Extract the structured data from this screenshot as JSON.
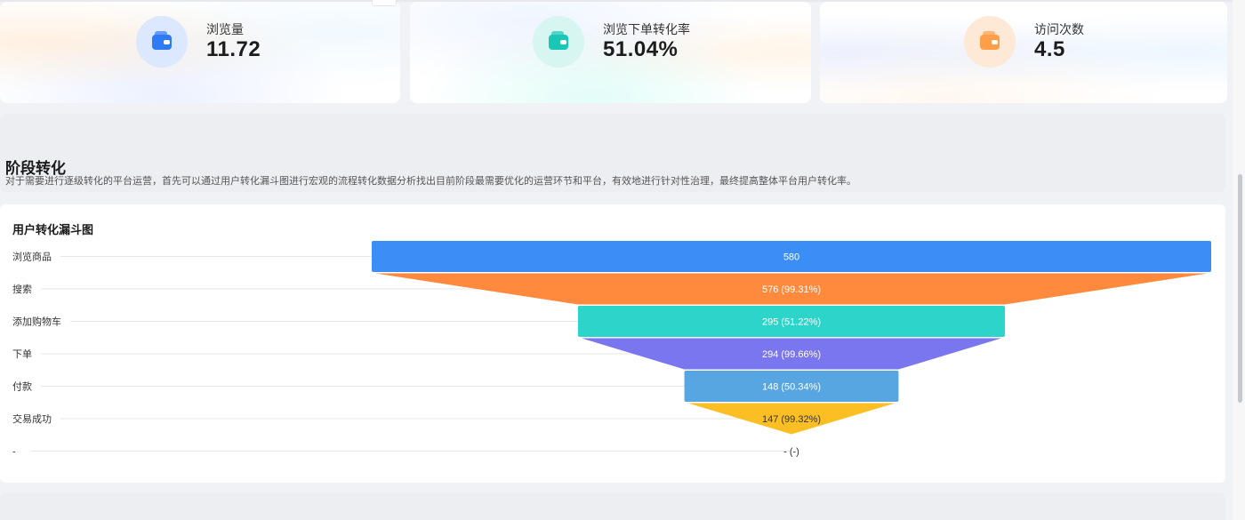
{
  "kpis": [
    {
      "label": "浏览量",
      "value": "11.72",
      "icon": "wallet-icon",
      "icon_color": "#2f7bf5",
      "icon_bg": "#dbe8fd"
    },
    {
      "label": "浏览下单转化率",
      "value": "51.04%",
      "icon": "wallet-icon",
      "icon_color": "#19c7b5",
      "icon_bg": "#d7f5f1"
    },
    {
      "label": "访问次数",
      "value": "4.5",
      "icon": "wallet-icon",
      "icon_color": "#ff9f4a",
      "icon_bg": "#fde9d6"
    }
  ],
  "section": {
    "title": "阶段转化",
    "description": "对于需要进行逐级转化的平台运营，首先可以通过用户转化漏斗图进行宏观的流程转化数据分析找出目前阶段最需要优化的运营环节和平台，有效地进行针对性治理，最终提高整体平台用户转化率。"
  },
  "chart_data": {
    "type": "funnel",
    "title": "用户转化漏斗图",
    "stages": [
      {
        "name": "浏览商品",
        "value": 580,
        "label": "580",
        "color": "#3a8ef6"
      },
      {
        "name": "搜索",
        "value": 576,
        "label": "576 (99.31%)",
        "color": "#ff8a3d"
      },
      {
        "name": "添加购物车",
        "value": 295,
        "label": "295 (51.22%)",
        "color": "#2dd4c9"
      },
      {
        "name": "下单",
        "value": 294,
        "label": "294 (99.66%)",
        "color": "#7a76f0"
      },
      {
        "name": "付款",
        "value": 148,
        "label": "148 (50.34%)",
        "color": "#57a6e2"
      },
      {
        "name": "交易成功",
        "value": 147,
        "label": "147 (99.32%)",
        "color": "#fbbf24"
      },
      {
        "name": "-",
        "value": null,
        "label": "- (-)",
        "color": "#cccccc"
      }
    ]
  }
}
